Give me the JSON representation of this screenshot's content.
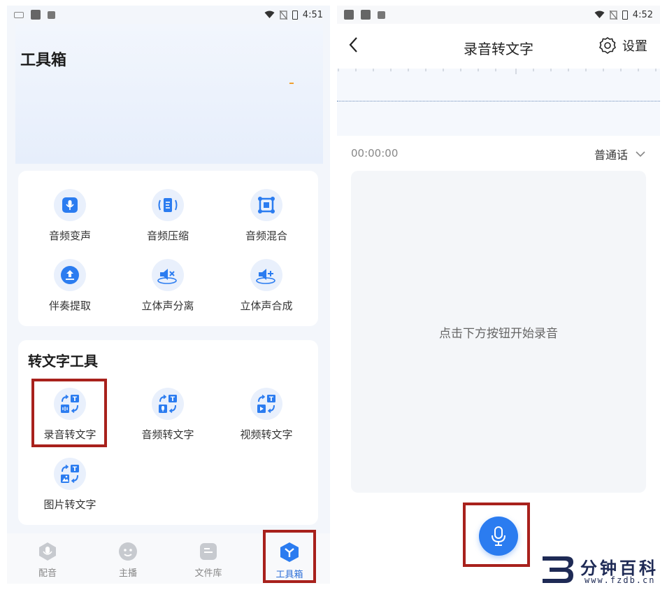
{
  "left": {
    "status": {
      "time": "4:51"
    },
    "header_title": "工具箱",
    "audio_tools": [
      {
        "label": "音频变声",
        "icon": "audio-voice-change-icon"
      },
      {
        "label": "音频压缩",
        "icon": "audio-compress-icon"
      },
      {
        "label": "音频混合",
        "icon": "audio-mix-icon"
      },
      {
        "label": "伴奏提取",
        "icon": "accompaniment-extract-icon"
      },
      {
        "label": "立体声分离",
        "icon": "stereo-separate-icon"
      },
      {
        "label": "立体声合成",
        "icon": "stereo-merge-icon"
      }
    ],
    "text_section_title": "转文字工具",
    "text_tools": [
      {
        "label": "录音转文字",
        "icon": "record-to-text-icon"
      },
      {
        "label": "音频转文字",
        "icon": "audio-to-text-icon"
      },
      {
        "label": "视频转文字",
        "icon": "video-to-text-icon"
      },
      {
        "label": "图片转文字",
        "icon": "image-to-text-icon"
      }
    ],
    "tabs": [
      {
        "label": "配音",
        "icon": "dubbing-icon",
        "active": false
      },
      {
        "label": "主播",
        "icon": "anchor-icon",
        "active": false
      },
      {
        "label": "文件库",
        "icon": "file-library-icon",
        "active": false
      },
      {
        "label": "工具箱",
        "icon": "toolbox-icon",
        "active": true
      }
    ]
  },
  "right": {
    "status": {
      "time": "4:52"
    },
    "title": "录音转文字",
    "settings_label": "设置",
    "timer": "00:00:00",
    "language": "普通话",
    "hint": "点击下方按钮开始录音"
  },
  "watermark": {
    "name": "分钟百科",
    "url": "www.fzdb.cn"
  },
  "colors": {
    "accent": "#2b7cf0",
    "highlight": "#a8211c",
    "icon_bg": "#e9f0fc"
  }
}
